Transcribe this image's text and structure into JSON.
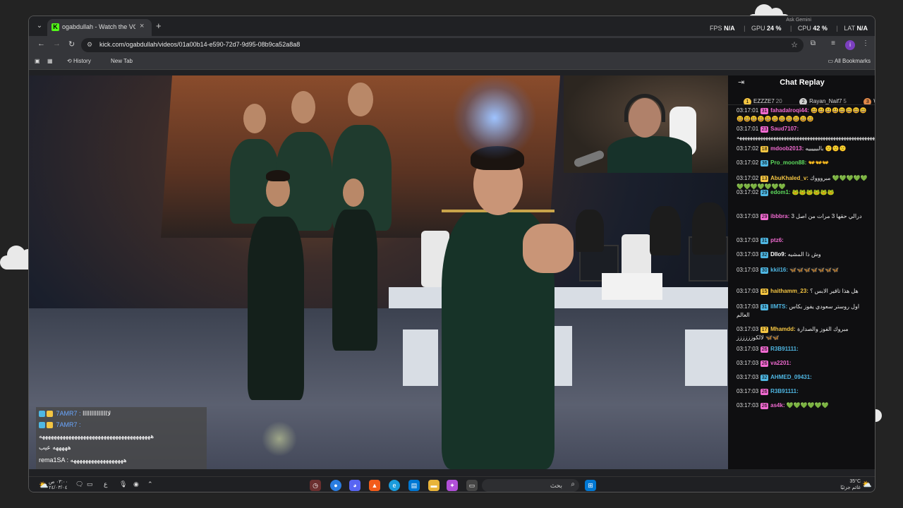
{
  "browser": {
    "tab_title": "ogabdullah - Watch the VOD o",
    "tab_favicon": "K",
    "url": "kick.com/ogabdullah/videos/01a00b14-e590-72d7-9d95-08b9ca52a8a8",
    "profile_initial": "i",
    "bookmarks": [
      {
        "label": "History"
      },
      {
        "label": "New Tab"
      }
    ],
    "all_bookmarks_label": "All Bookmarks"
  },
  "perf_overlay": {
    "fps_label": "FPS",
    "fps_value": "N/A",
    "gpu_label": "GPU",
    "gpu_value": "24 %",
    "cpu_label": "CPU",
    "cpu_value": "42 %",
    "lat_label": "LAT",
    "lat_value": "N/A",
    "overlay_text": "Ask Gemini"
  },
  "video_chat_overlay": [
    {
      "user": "7AMR7 :",
      "text": "لااااااااااااااا"
    },
    {
      "user": "7AMR7 :",
      "text": ""
    },
    {
      "user": "",
      "text": "ههههههههههههههههههههههههههههههههههههههه"
    },
    {
      "user": "",
      "text": "هههههه عيب"
    },
    {
      "user": "rema1SA :",
      "text": "ههههههههههههههههههه"
    }
  ],
  "chat": {
    "title": "Chat Replay",
    "top_gifters": [
      {
        "rank": "1",
        "name": "EZZZE7",
        "count": "20",
        "color": "#f4c542"
      },
      {
        "rank": "2",
        "name": "Rayan_Naif7",
        "count": "5",
        "color": "#cfcfcf"
      },
      {
        "rank": "3",
        "name": "W",
        "count": "",
        "color": "#e0894a"
      }
    ],
    "messages": [
      {
        "time": "03:17:01",
        "lvl": "31",
        "lvl_color": "#f06ad0",
        "user": "fahadalroqi44:",
        "user_color": "#f06ad0",
        "text": "😃😃😃😃😃😃😃😃😃😃😃😃😃😃😃😃😃😃😃"
      },
      {
        "time": "03:17:01",
        "lvl": "23",
        "lvl_color": "#f06ad0",
        "user": "Saud7107:",
        "user_color": "#f06ad0",
        "text": "هههههههههههههههههههههههههههههههههههههههههههههههههههههههههههههههه"
      },
      {
        "time": "03:17:02",
        "lvl": "18",
        "lvl_color": "#f4c542",
        "user": "mdoob2013:",
        "user_color": "#f06ad0",
        "text": "بالبيييييه 🙁🙁🙁"
      },
      {
        "time": "03:17:02",
        "lvl": "36",
        "lvl_color": "#4fb7e3",
        "user": "Pro_moon88:",
        "user_color": "#5ddc5d",
        "text": "👐👐👐"
      },
      {
        "time": "03:17:02",
        "lvl": "13",
        "lvl_color": "#f4c542",
        "user": "AbuKhaled_v:",
        "user_color": "#f4c542",
        "text": "مبروووك 💚💚💚💚💚💚💚💚💚💚💚💚"
      },
      {
        "time": "03:17:02",
        "lvl": "29",
        "lvl_color": "#4fb7e3",
        "user": "edom1:",
        "user_color": "#5ddc5d",
        "text": "🐸🐸🐸🐸🐸🐸"
      },
      {
        "time": "03:17:03",
        "lvl": "29",
        "lvl_color": "#f06ad0",
        "user": "ibbbra:",
        "user_color": "#f06ad0",
        "text": "درالي حقها 3 مرات من اصل 3"
      },
      {
        "time": "03:17:03",
        "lvl": "31",
        "lvl_color": "#4fb7e3",
        "user": "ptz6:",
        "user_color": "#f06ad0",
        "text": ""
      },
      {
        "time": "03:17:03",
        "lvl": "32",
        "lvl_color": "#4fb7e3",
        "user": "Dllo9:",
        "user_color": "#fff",
        "text": "وش ذا المشيه"
      },
      {
        "time": "03:17:03",
        "lvl": "30",
        "lvl_color": "#4fb7e3",
        "user": "kkil16:",
        "user_color": "#4fb7e3",
        "text": "🦋🦋🦋🦋🦋🦋🦋"
      },
      {
        "time": "03:17:03",
        "lvl": "15",
        "lvl_color": "#f4c542",
        "user": "haithamm_23:",
        "user_color": "#f4c542",
        "text": "هل هذا تاقير الابس ؟"
      },
      {
        "time": "03:17:03",
        "lvl": "31",
        "lvl_color": "#4fb7e3",
        "user": "IIMTS:",
        "user_color": "#4fb7e3",
        "text": "اول روستر سعودي يفوز بكاس العالم"
      },
      {
        "time": "03:17:03",
        "lvl": "17",
        "lvl_color": "#f4c542",
        "user": "Mhamdd:",
        "user_color": "#f4c542",
        "text": "مبروك الفوز والصدارة لالكوزززززز 🦋🦋"
      },
      {
        "time": "03:17:03",
        "lvl": "26",
        "lvl_color": "#f06ad0",
        "user": "R3B91111:",
        "user_color": "#4fb7e3",
        "text": ""
      },
      {
        "time": "03:17:03",
        "lvl": "26",
        "lvl_color": "#f06ad0",
        "user": "va2201:",
        "user_color": "#f06ad0",
        "text": ""
      },
      {
        "time": "03:17:03",
        "lvl": "32",
        "lvl_color": "#4fb7e3",
        "user": "AHMED_09431:",
        "user_color": "#4fb7e3",
        "text": ""
      },
      {
        "time": "03:17:03",
        "lvl": "26",
        "lvl_color": "#f06ad0",
        "user": "R3B91111:",
        "user_color": "#4fb7e3",
        "text": ""
      },
      {
        "time": "03:17:03",
        "lvl": "26",
        "lvl_color": "#f06ad0",
        "user": "as4k:",
        "user_color": "#f06ad0",
        "text": "💚💚💚💚💚💚"
      }
    ]
  },
  "taskbar": {
    "time": "٠٣:٠٠ ص",
    "date": "٢٤/٠٣/٠٤",
    "lang": "ع",
    "search_placeholder": "بحث",
    "temperature": "35°C",
    "weather_text": "غائم جزئيًا"
  },
  "colors": {
    "kick_green": "#53fc18",
    "chat_bg": "#0f0f11",
    "browser_bg": "#202124"
  }
}
